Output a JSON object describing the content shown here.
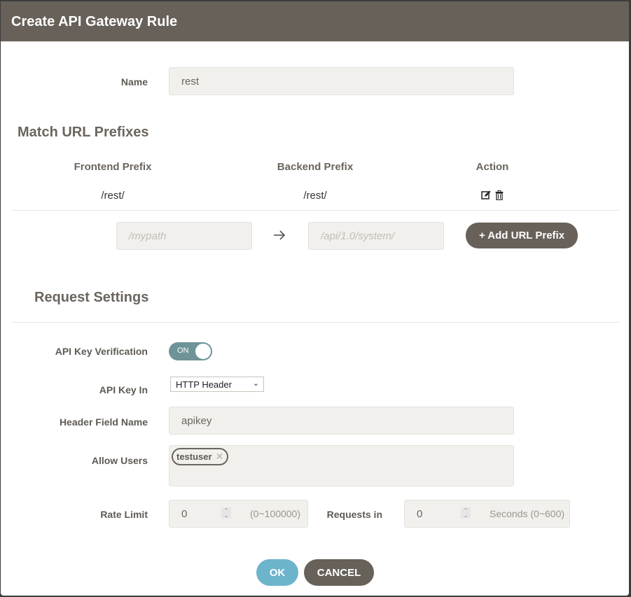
{
  "dialog": {
    "title": "Create API Gateway Rule"
  },
  "name_field": {
    "label": "Name",
    "value": "rest"
  },
  "match_url": {
    "section_title": "Match URL Prefixes",
    "columns": [
      "Frontend Prefix",
      "Backend Prefix",
      "Action"
    ],
    "rows": [
      {
        "frontend": "/rest/",
        "backend": "/rest/",
        "actions": [
          "edit-icon",
          "trash-icon"
        ]
      }
    ],
    "new_frontend_placeholder": "/mypath",
    "new_backend_placeholder": "/api/1.0/system/",
    "arrow_icon": "arrow-right-icon",
    "add_button_label": "+ Add URL Prefix"
  },
  "request_settings": {
    "section_title": "Request Settings",
    "api_key_verification": {
      "label": "API Key Verification",
      "state": "ON"
    },
    "api_key_in": {
      "label": "API Key In",
      "selected": "HTTP Header"
    },
    "header_field_name": {
      "label": "Header Field Name",
      "value": "apikey"
    },
    "allow_users": {
      "label": "Allow Users",
      "tags": [
        "testuser"
      ]
    },
    "rate_limit": {
      "label": "Rate Limit",
      "value": "0",
      "hint": "(0~100000)"
    },
    "requests_in": {
      "label": "Requests in",
      "value": "0",
      "hint": "Seconds (0~600)"
    }
  },
  "footer": {
    "ok_label": "OK",
    "cancel_label": "CANCEL"
  },
  "colors": {
    "header_bg": "#676159",
    "ok_button": "#6cb4cb",
    "toggle_on": "#6e9398"
  }
}
